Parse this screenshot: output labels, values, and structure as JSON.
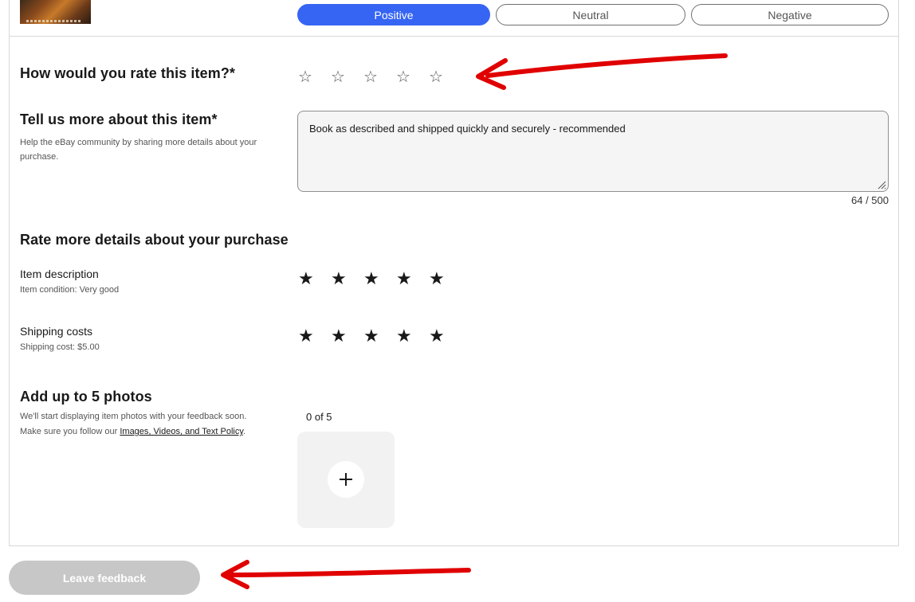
{
  "sentiment": {
    "options": [
      "Positive",
      "Neutral",
      "Negative"
    ],
    "selected": "Positive",
    "selected_color": "#3665f3"
  },
  "rating": {
    "title": "How would you rate this item?*",
    "stars_total": 5,
    "stars_filled": 0
  },
  "comment": {
    "title": "Tell us more about this item*",
    "help": "Help the eBay community by sharing more details about your purchase.",
    "value": "Book as described and shipped quickly and securely - recommended",
    "count": "64 / 500"
  },
  "details": {
    "title": "Rate more details about your purchase",
    "rows": [
      {
        "label": "Item description",
        "sub": "Item condition: Very good",
        "stars_filled": 5
      },
      {
        "label": "Shipping costs",
        "sub": "Shipping cost: $5.00",
        "stars_filled": 5
      }
    ]
  },
  "photos": {
    "title": "Add up to 5 photos",
    "line1": "We'll start displaying item photos with your feedback soon.",
    "line2_prefix": "Make sure you follow our ",
    "policy_link": "Images, Videos, and Text Policy",
    "line2_suffix": ".",
    "count": "0 of 5"
  },
  "submit": {
    "label": "Leave feedback",
    "disabled_color": "#c7c7c7"
  },
  "annotation": {
    "arrow_color": "#e00000"
  }
}
